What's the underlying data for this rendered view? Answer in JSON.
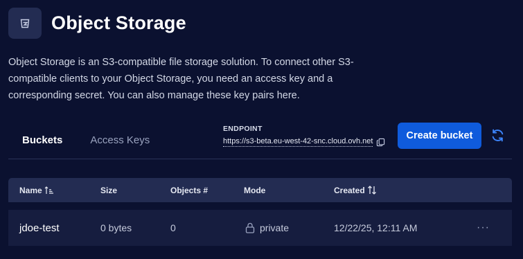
{
  "header": {
    "icon": "bucket-icon",
    "title": "Object Storage"
  },
  "description": "Object Storage is an S3-compatible file storage solution. To connect other S3-compatible clients to your Object Storage, you need an access key and a corresponding secret. You can also manage these key pairs here.",
  "tabs": [
    {
      "label": "Buckets",
      "active": true
    },
    {
      "label": "Access Keys",
      "active": false
    }
  ],
  "endpoint": {
    "label": "ENDPOINT",
    "url": "https://s3-beta.eu-west-42-snc.cloud.ovh.net",
    "copy_icon": "copy-icon"
  },
  "actions": {
    "create_label": "Create bucket",
    "refresh_icon": "refresh-icon"
  },
  "colors": {
    "background": "#0b1130",
    "primary": "#0f5bdc",
    "table_header": "#232c52",
    "table_row": "#161d3f"
  },
  "table": {
    "columns": [
      {
        "label": "Name",
        "sort_icon": "sort-ascending-icon"
      },
      {
        "label": "Size"
      },
      {
        "label": "Objects #"
      },
      {
        "label": "Mode"
      },
      {
        "label": "Created",
        "sort_icon": "sort-arrows-icon"
      }
    ],
    "rows": [
      {
        "name": "jdoe-test",
        "size": "0 bytes",
        "objects": "0",
        "mode": "private",
        "mode_icon": "lock-icon",
        "created": "12/22/25, 12:11 AM",
        "more": "···"
      }
    ]
  }
}
